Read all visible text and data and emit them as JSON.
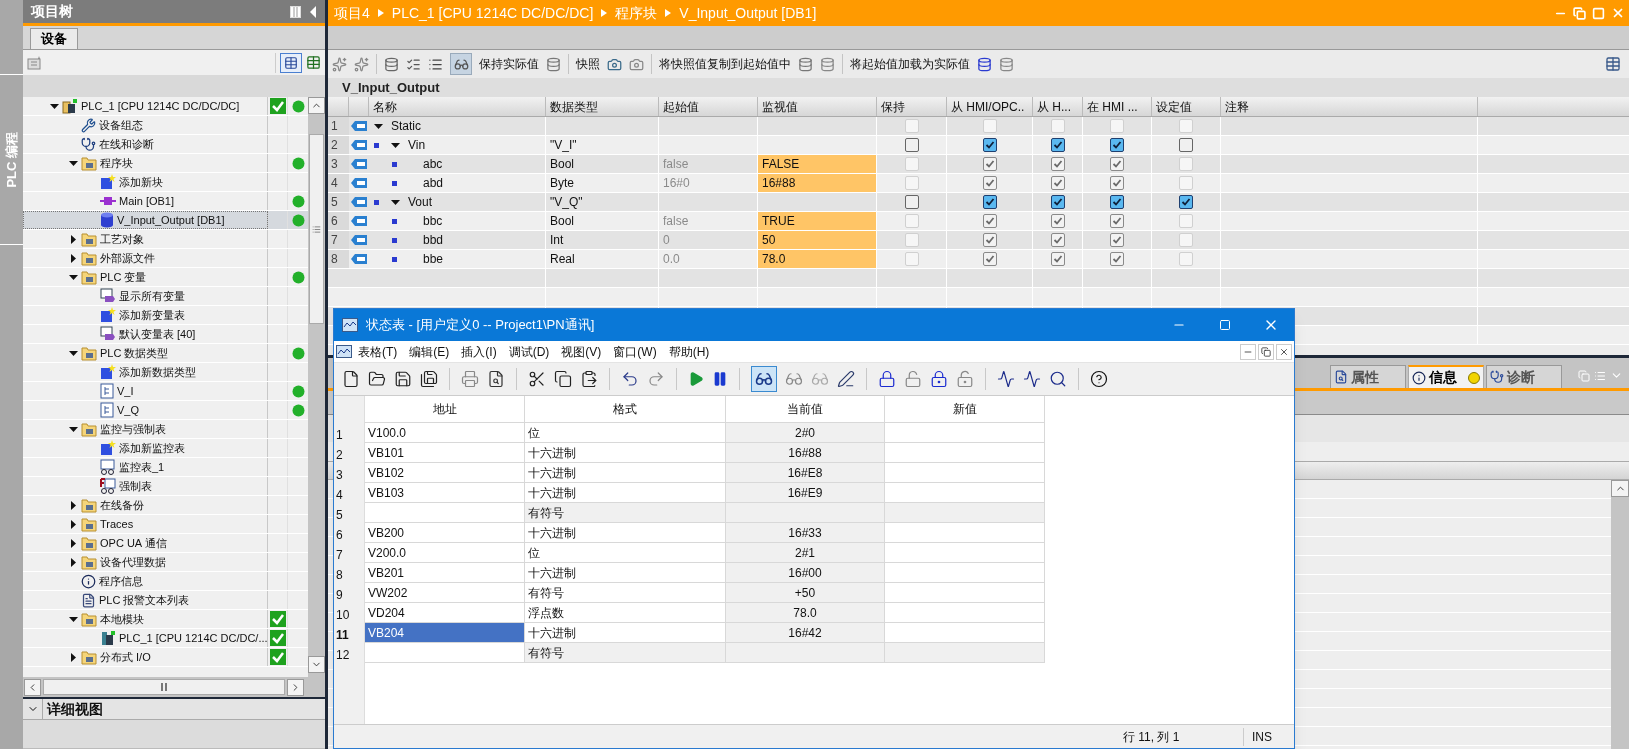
{
  "side_strip": {
    "label": "PLC 编程"
  },
  "project_tree": {
    "title": "项目树",
    "tabs": [
      {
        "label": "设备",
        "selected": true
      }
    ],
    "items": [
      {
        "kind": "plc",
        "label": "PLC_1 [CPU 1214C DC/DC/DC]",
        "expanded": true,
        "selected": false,
        "consistent": true,
        "online": true,
        "children": [
          {
            "kind": "device-config",
            "label": "设备组态",
            "selected": false
          },
          {
            "kind": "diagnostics",
            "label": "在线和诊断",
            "selected": false
          },
          {
            "kind": "folder",
            "label": "程序块",
            "expanded": true,
            "selected": false,
            "online": true,
            "children": [
              {
                "kind": "add",
                "label": "添加新块",
                "selected": false
              },
              {
                "kind": "ob",
                "label": "Main [OB1]",
                "selected": false,
                "online": true
              },
              {
                "kind": "db",
                "label": "V_Input_Output [DB1]",
                "selected": true,
                "online": true
              }
            ]
          },
          {
            "kind": "folder",
            "label": "工艺对象",
            "expanded": false,
            "selected": false
          },
          {
            "kind": "folder",
            "label": "外部源文件",
            "expanded": false,
            "selected": false
          },
          {
            "kind": "folder",
            "label": "PLC 变量",
            "expanded": true,
            "selected": false,
            "online": true,
            "children": [
              {
                "kind": "tags",
                "label": "显示所有变量",
                "selected": false
              },
              {
                "kind": "add",
                "label": "添加新变量表",
                "selected": false
              },
              {
                "kind": "tags",
                "label": "默认变量表 [40]",
                "selected": false
              }
            ]
          },
          {
            "kind": "folder",
            "label": "PLC 数据类型",
            "expanded": true,
            "selected": false,
            "online": true,
            "children": [
              {
                "kind": "add",
                "label": "添加新数据类型",
                "selected": false
              },
              {
                "kind": "udt",
                "label": "V_I",
                "selected": false,
                "online": true
              },
              {
                "kind": "udt",
                "label": "V_Q",
                "selected": false,
                "online": true
              }
            ]
          },
          {
            "kind": "folder",
            "label": "监控与强制表",
            "expanded": true,
            "selected": false,
            "children": [
              {
                "kind": "add",
                "label": "添加新监控表",
                "selected": false
              },
              {
                "kind": "watch",
                "label": "监控表_1",
                "selected": false
              },
              {
                "kind": "force",
                "label": "强制表",
                "selected": false
              }
            ]
          },
          {
            "kind": "folder",
            "label": "在线备份",
            "expanded": false,
            "selected": false
          },
          {
            "kind": "folder",
            "label": "Traces",
            "expanded": false,
            "selected": false
          },
          {
            "kind": "folder",
            "label": "OPC UA 通信",
            "expanded": false,
            "selected": false
          },
          {
            "kind": "folder",
            "label": "设备代理数据",
            "expanded": false,
            "selected": false
          },
          {
            "kind": "info",
            "label": "程序信息",
            "selected": false
          },
          {
            "kind": "text-list",
            "label": "PLC 报警文本列表",
            "selected": false
          },
          {
            "kind": "folder",
            "label": "本地模块",
            "expanded": true,
            "selected": false,
            "consistent": true,
            "children": [
              {
                "kind": "cpu",
                "label": "PLC_1 [CPU 1214C DC/DC/...",
                "selected": false,
                "consistent": true
              }
            ]
          },
          {
            "kind": "folder",
            "label": "分布式 I/O",
            "expanded": false,
            "selected": false,
            "consistent": true
          }
        ]
      }
    ],
    "detail_view": {
      "title": "详细视图",
      "expanded": true
    }
  },
  "editor": {
    "breadcrumb": [
      "项目4",
      "PLC_1 [CPU 1214C DC/DC/DC]",
      "程序块",
      "V_Input_Output [DB1]"
    ],
    "toolbar": {
      "monitor_all": true,
      "buttons": [
        "保持实际值",
        "快照",
        "将快照值复制到起始值中",
        "将起始值加载为实际值"
      ]
    },
    "block_title": "V_Input_Output",
    "columns": [
      "名称",
      "数据类型",
      "起始值",
      "监视值",
      "保持",
      "从 HMI/OPC..",
      "从 H...",
      "在 HMI ...",
      "设定值",
      "注释"
    ],
    "rows": [
      {
        "num": "1",
        "name": "Static",
        "expanded": true,
        "retain": {
          "checked": false,
          "disabled": true
        },
        "hmi_opc": {
          "checked": false,
          "disabled": true
        },
        "from_hmi": {
          "checked": false,
          "disabled": true
        },
        "in_hmi": {
          "checked": false,
          "disabled": true
        },
        "setpoint": {
          "checked": false,
          "disabled": true
        },
        "children": [
          {
            "num": "2",
            "name": "Vin",
            "expanded": true,
            "type": "\"V_I\"",
            "retain": {
              "checked": false,
              "disabled": false
            },
            "hmi_opc": {
              "checked": true,
              "disabled": false
            },
            "from_hmi": {
              "checked": true,
              "disabled": false
            },
            "in_hmi": {
              "checked": true,
              "disabled": false
            },
            "setpoint": {
              "checked": false,
              "disabled": false
            },
            "children": [
              {
                "num": "3",
                "name": "abc",
                "type": "Bool",
                "start": "false",
                "monitor": "FALSE",
                "retain": {
                  "checked": false,
                  "disabled": true
                },
                "hmi_opc": {
                  "checked": true,
                  "disabled": true
                },
                "from_hmi": {
                  "checked": true,
                  "disabled": true
                },
                "in_hmi": {
                  "checked": true,
                  "disabled": true
                },
                "setpoint": {
                  "checked": false,
                  "disabled": true
                }
              },
              {
                "num": "4",
                "name": "abd",
                "type": "Byte",
                "start": "16#0",
                "monitor": "16#88",
                "retain": {
                  "checked": false,
                  "disabled": true
                },
                "hmi_opc": {
                  "checked": true,
                  "disabled": true
                },
                "from_hmi": {
                  "checked": true,
                  "disabled": true
                },
                "in_hmi": {
                  "checked": true,
                  "disabled": true
                },
                "setpoint": {
                  "checked": false,
                  "disabled": true
                }
              }
            ]
          },
          {
            "num": "5",
            "name": "Vout",
            "expanded": true,
            "type": "\"V_Q\"",
            "retain": {
              "checked": false,
              "disabled": false
            },
            "hmi_opc": {
              "checked": true,
              "disabled": false
            },
            "from_hmi": {
              "checked": true,
              "disabled": false
            },
            "in_hmi": {
              "checked": true,
              "disabled": false
            },
            "setpoint": {
              "checked": true,
              "disabled": false
            },
            "children": [
              {
                "num": "6",
                "name": "bbc",
                "type": "Bool",
                "start": "false",
                "monitor": "TRUE",
                "retain": {
                  "checked": false,
                  "disabled": true
                },
                "hmi_opc": {
                  "checked": true,
                  "disabled": true
                },
                "from_hmi": {
                  "checked": true,
                  "disabled": true
                },
                "in_hmi": {
                  "checked": true,
                  "disabled": true
                },
                "setpoint": {
                  "checked": false,
                  "disabled": true
                }
              },
              {
                "num": "7",
                "name": "bbd",
                "type": "Int",
                "start": "0",
                "monitor": "50",
                "retain": {
                  "checked": false,
                  "disabled": true
                },
                "hmi_opc": {
                  "checked": true,
                  "disabled": true
                },
                "from_hmi": {
                  "checked": true,
                  "disabled": true
                },
                "in_hmi": {
                  "checked": true,
                  "disabled": true
                },
                "setpoint": {
                  "checked": false,
                  "disabled": true
                }
              },
              {
                "num": "8",
                "name": "bbe",
                "type": "Real",
                "start": "0.0",
                "monitor": "78.0",
                "retain": {
                  "checked": false,
                  "disabled": true
                },
                "hmi_opc": {
                  "checked": true,
                  "disabled": true
                },
                "from_hmi": {
                  "checked": true,
                  "disabled": true
                },
                "in_hmi": {
                  "checked": true,
                  "disabled": true
                },
                "setpoint": {
                  "checked": false,
                  "disabled": true
                }
              }
            ]
          }
        ]
      }
    ]
  },
  "inspector": {
    "tabs": [
      {
        "label": "属性",
        "selected": false,
        "has_info": false
      },
      {
        "label": "信息",
        "selected": true,
        "has_info": true
      },
      {
        "label": "诊断",
        "selected": false,
        "has_info": false
      }
    ]
  },
  "status_window": {
    "title": "状态表 - [用户定义0 -- Project1\\PN通讯]",
    "menu": [
      "表格(T)",
      "编辑(E)",
      "插入(I)",
      "调试(D)",
      "视图(V)",
      "窗口(W)",
      "帮助(H)"
    ],
    "monitoring": true,
    "columns": [
      "地址",
      "格式",
      "当前值",
      "新值"
    ],
    "rows": [
      {
        "num": "1",
        "address": "V100.0",
        "format": "位",
        "current": "2#0",
        "selected": false
      },
      {
        "num": "2",
        "address": "VB101",
        "format": "十六进制",
        "current": "16#88",
        "selected": false
      },
      {
        "num": "3",
        "address": "VB102",
        "format": "十六进制",
        "current": "16#E8",
        "selected": false
      },
      {
        "num": "4",
        "address": "VB103",
        "format": "十六进制",
        "current": "16#E9",
        "selected": false
      },
      {
        "num": "5",
        "format": "有符号",
        "selected": false
      },
      {
        "num": "6",
        "address": "VB200",
        "format": "十六进制",
        "current": "16#33",
        "selected": false
      },
      {
        "num": "7",
        "address": "V200.0",
        "format": "位",
        "current": "2#1",
        "selected": false
      },
      {
        "num": "8",
        "address": "VB201",
        "format": "十六进制",
        "current": "16#00",
        "selected": false
      },
      {
        "num": "9",
        "address": "VW202",
        "format": "有符号",
        "current": "+50",
        "selected": false
      },
      {
        "num": "10",
        "address": "VD204",
        "format": "浮点数",
        "current": "78.0",
        "selected": false
      },
      {
        "num": "11",
        "address": "VB204",
        "format": "十六进制",
        "current": "16#42",
        "selected": true
      },
      {
        "num": "12",
        "format": "有符号",
        "selected": false
      }
    ],
    "status": {
      "position": "行 11, 列 1",
      "mode": "INS"
    }
  }
}
